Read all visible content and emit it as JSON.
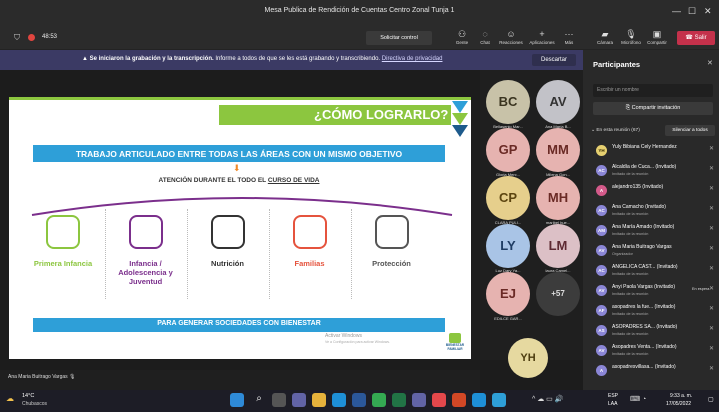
{
  "window": {
    "title": "Mesa Publica de Rendición de Cuentas Centro Zonal Tunja 1"
  },
  "meeting": {
    "timer": "48:53",
    "request_control": "Solicitar control",
    "buttons": [
      "Gente",
      "Chat",
      "Reacciones",
      "Aplicaciones",
      "Más",
      "Cámara",
      "Micrófono",
      "Compartir"
    ],
    "leave": "Salir"
  },
  "banner": {
    "text": "Se iniciaron la grabación y la transcripción.",
    "detail": "Informe a todos de que se les está grabando y transcribiendo.",
    "link": "Directiva de privacidad",
    "dismiss": "Descartar"
  },
  "slide": {
    "title": "¿CÓMO LOGRARLO?",
    "band1": "TRABAJO ARTICULADO ENTRE TODAS LAS ÁREAS CON UN MISMO OBJETIVO",
    "sub_prefix": "ATENCIÓN DURANTE EL TODO EL ",
    "sub_link": "CURSO DE VIDA",
    "columns": [
      {
        "label": "Primera Infancia",
        "color": "#8cc63f",
        "icon": "baby-icon"
      },
      {
        "label": "Infancia / Adolescencia y Juventud",
        "color": "#7b2f8c",
        "icon": "child-icon"
      },
      {
        "label": "Nutrición",
        "color": "#333333",
        "icon": "food-icon"
      },
      {
        "label": "Familias",
        "color": "#e5533d",
        "icon": "family-icon"
      },
      {
        "label": "Protección",
        "color": "#555555",
        "icon": "protection-icon"
      }
    ],
    "band2": "PARA GENERAR SOCIEDADES CON BIENESTAR",
    "watermark1": "Activar Windows",
    "watermark2": "Ve a Configuración para activar Windows.",
    "logo_text": "BIENESTAR FAMILIAR"
  },
  "grid": [
    {
      "initials": "BC",
      "name": "Bellasenio Mar...",
      "bg": "#c8c2a8",
      "fg": "#3a3420"
    },
    {
      "initials": "AV",
      "name": "Ana María B...",
      "bg": "#c2c2c8",
      "fg": "#333"
    },
    {
      "initials": "GP",
      "name": "Gloria Merc...",
      "bg": "#e6b3b0",
      "fg": "#6a2a25"
    },
    {
      "initials": "MM",
      "name": "Milena Gon...",
      "bg": "#e6b3b0",
      "fg": "#6a2a25"
    },
    {
      "initials": "CP",
      "name": "CLARA PULI...",
      "bg": "#e6cf8c",
      "fg": "#5c4510"
    },
    {
      "initials": "MH",
      "name": "maribel hue...",
      "bg": "#e6b3b0",
      "fg": "#6a2a25"
    },
    {
      "initials": "LY",
      "name": "Luz Dary Ya...",
      "bg": "#a9c4e6",
      "fg": "#1f3c63"
    },
    {
      "initials": "LM",
      "name": "laura Camel...",
      "bg": "#dcc0c6",
      "fg": "#5e2a33"
    },
    {
      "initials": "EJ",
      "name": "EDILCE GAR...",
      "bg": "#e6b3b0",
      "fg": "#6a2a25"
    },
    {
      "initials": "+57",
      "name": "",
      "bg": "#3c3c3c",
      "fg": "#ddd"
    }
  ],
  "presenter": {
    "initials": "YH",
    "bg": "#e6d9a0",
    "fg": "#4d3d10",
    "name": "Ana Maria Buitrago Vargas"
  },
  "panel": {
    "title": "Participantes",
    "search_placeholder": "Escribir un nombre",
    "share": "Compartir invitación",
    "section": "En esta reunión (67)",
    "mute_all": "Silenciar a todos",
    "people": [
      {
        "initials": "YH",
        "name": "Yuly Bibiana Cely Hernandez",
        "sub": "",
        "bg": "#e6d070",
        "fg": "#3a2d00"
      },
      {
        "initials": "AC",
        "name": "Alcaldía de Cuca...",
        "tag": "(Invitado)",
        "sub": "Invitado de la reunión",
        "bg": "#8b86d6",
        "fg": "#fff"
      },
      {
        "initials": "A",
        "name": "alejandro135 (Invitado)",
        "sub": "",
        "bg": "#d45a8a",
        "fg": "#fff"
      },
      {
        "initials": "AC",
        "name": "Ana Camacho",
        "tag": "(Invitado)",
        "sub": "Invitado de la reunión",
        "bg": "#8b86d6",
        "fg": "#fff"
      },
      {
        "initials": "AM",
        "name": "Ana María Amado",
        "tag": "(Invitado)",
        "sub": "Invitado de la reunión",
        "bg": "#8b86d6",
        "fg": "#fff"
      },
      {
        "initials": "AV",
        "name": "Ana Maria Buitrago Vargas",
        "sub": "Organizador",
        "bg": "#8b86d6",
        "fg": "#fff"
      },
      {
        "initials": "AC",
        "name": "ANGELICA CAST...",
        "tag": "(Invitado)",
        "sub": "Invitado de la reunión",
        "bg": "#8b86d6",
        "fg": "#fff"
      },
      {
        "initials": "AV",
        "name": "Anyi Paola Vargas",
        "tag": "(Invitado)",
        "sub": "Invitado de la reunión",
        "extra": "En espera",
        "bg": "#8b86d6",
        "fg": "#fff"
      },
      {
        "initials": "AF",
        "name": "asopadres la fue...",
        "tag": "(Invitado)",
        "sub": "Invitado de la reunión",
        "bg": "#8b86d6",
        "fg": "#fff"
      },
      {
        "initials": "AS",
        "name": "ASOPADRES SA...",
        "tag": "(Invitado)",
        "sub": "Invitado de la reunión",
        "bg": "#8b86d6",
        "fg": "#fff"
      },
      {
        "initials": "AV",
        "name": "Asopadres Venta...",
        "tag": "(Invitado)",
        "sub": "Invitado de la reunión",
        "bg": "#8b86d6",
        "fg": "#fff"
      },
      {
        "initials": "A",
        "name": "asopadresvillasa...",
        "tag": "(Invitado)",
        "sub": "",
        "bg": "#8b86d6",
        "fg": "#fff"
      }
    ]
  },
  "taskbar": {
    "temp": "14°C",
    "weather": "Chubascos",
    "lang1": "ESP",
    "lang2": "LAA",
    "time": "9:33 a. m.",
    "date": "17/05/2022"
  }
}
